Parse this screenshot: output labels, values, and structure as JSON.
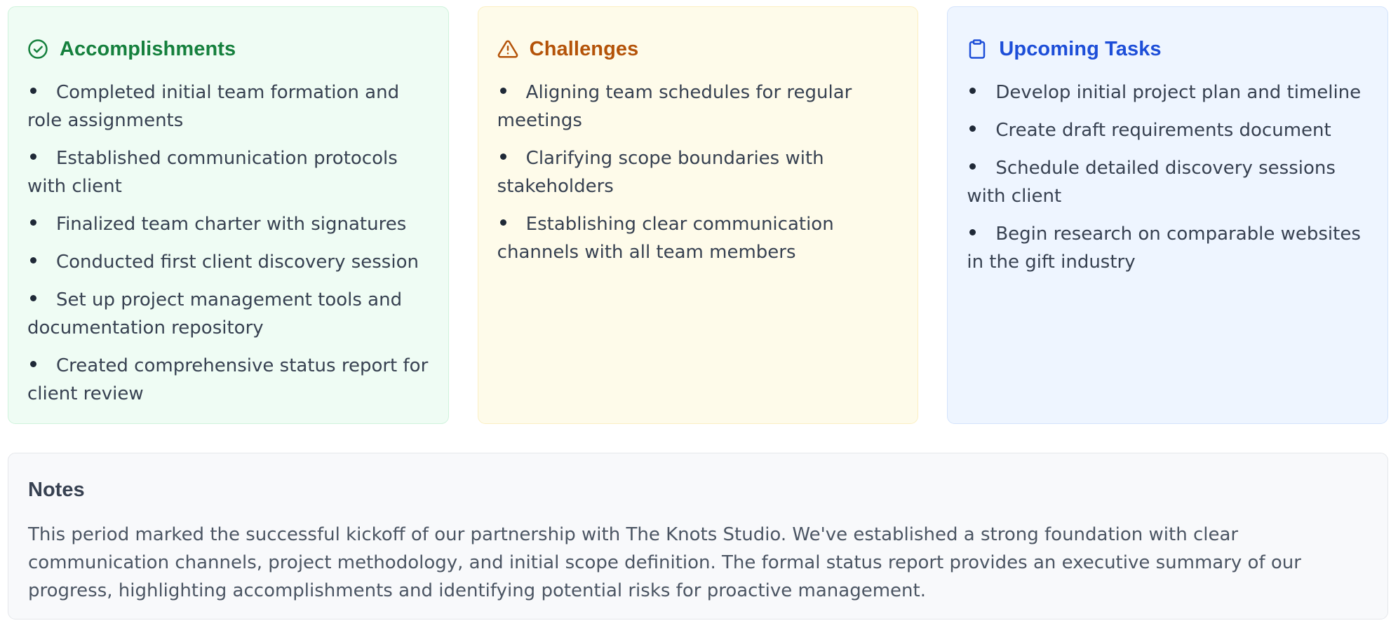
{
  "accomplishments": {
    "title": "Accomplishments",
    "icon": "check-circle-icon",
    "color": "#15803d",
    "items": [
      "Completed initial team formation and role assignments",
      "Established communication protocols with client",
      "Finalized team charter with signatures",
      "Conducted first client discovery session",
      "Set up project management tools and documentation repository",
      "Created comprehensive status report for client review"
    ]
  },
  "challenges": {
    "title": "Challenges",
    "icon": "warning-triangle-icon",
    "color": "#b45309",
    "items": [
      "Aligning team schedules for regular meetings",
      "Clarifying scope boundaries with stakeholders",
      "Establishing clear communication channels with all team members"
    ]
  },
  "upcoming": {
    "title": "Upcoming Tasks",
    "icon": "clipboard-icon",
    "color": "#1d4ed8",
    "items": [
      "Develop initial project plan and timeline",
      "Create draft requirements document",
      "Schedule detailed discovery sessions with client",
      "Begin research on comparable websites in the gift industry"
    ]
  },
  "notes": {
    "title": "Notes",
    "body": "This period marked the successful kickoff of our partnership with The Knots Studio. We've established a strong foundation with clear communication channels, project methodology, and initial scope definition. The formal status report provides an executive summary of our progress, highlighting accomplishments and identifying potential risks for proactive management."
  }
}
